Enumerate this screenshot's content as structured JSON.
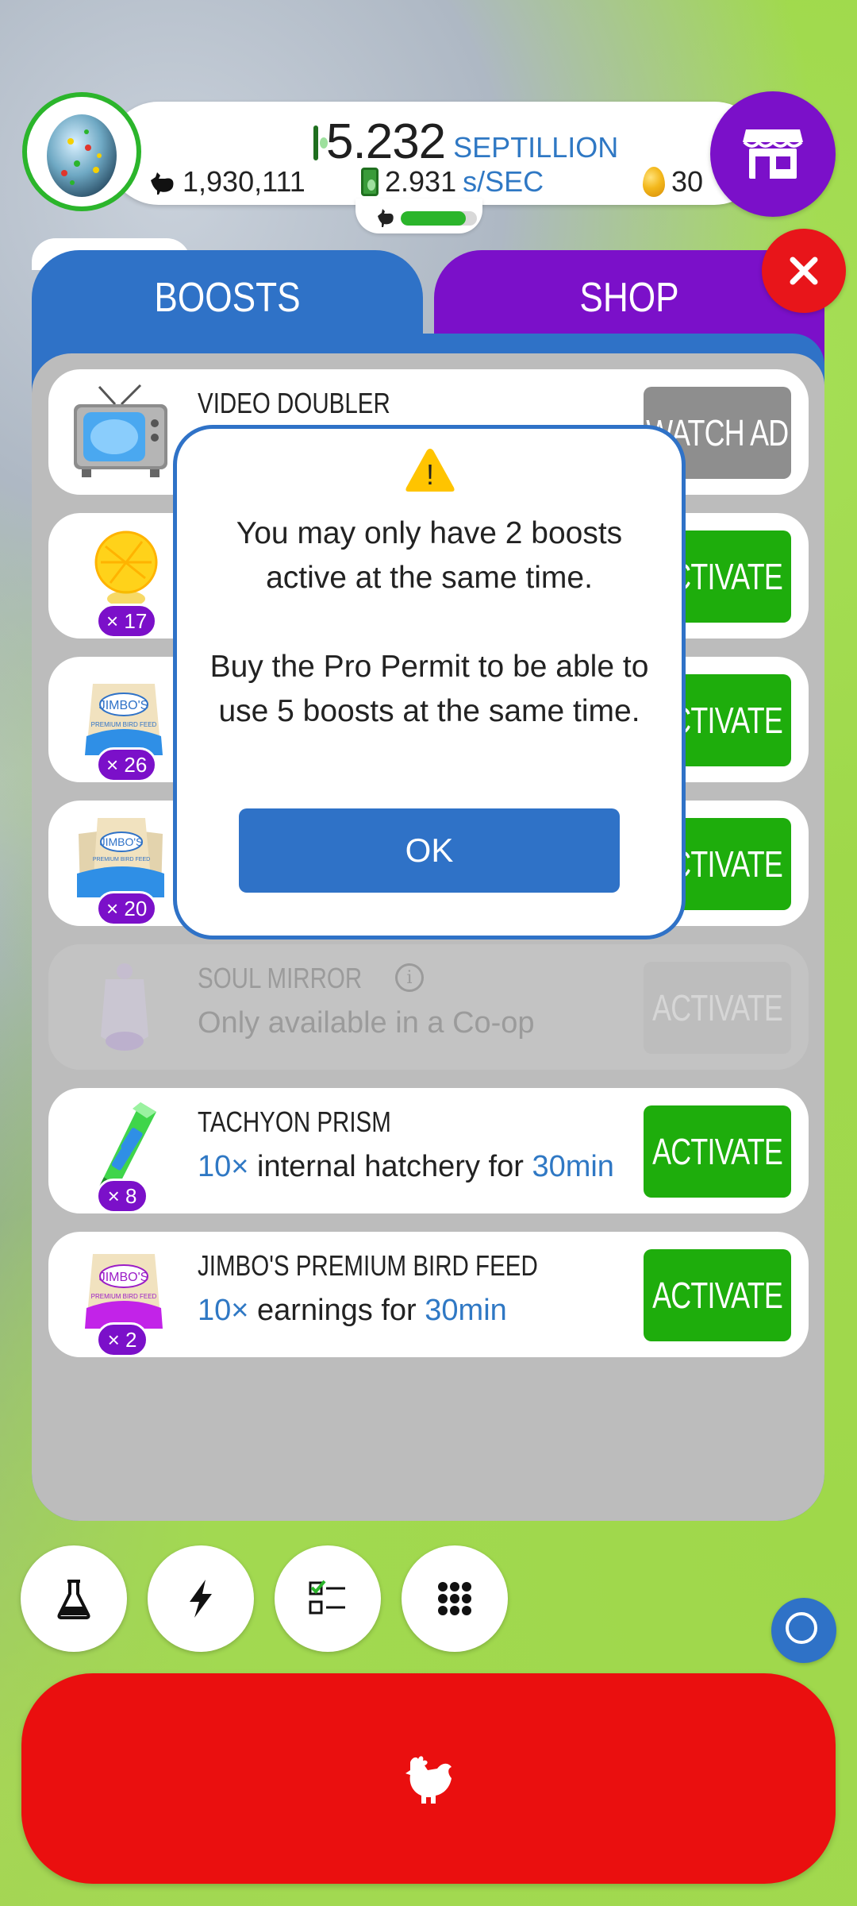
{
  "hud": {
    "money_value": "5.232",
    "money_unit": "SEPTILLION",
    "chicken_count": "1,930,111",
    "rate_value": "2.931",
    "rate_unit": "s/SEC",
    "golden_eggs": "30",
    "habitat_progress": 0.85
  },
  "tabs": [
    {
      "label": "BOOSTS",
      "selected": true
    },
    {
      "label": "SHOP",
      "selected": false
    }
  ],
  "boosts": [
    {
      "title": "VIDEO DOUBLER",
      "count": "",
      "action": "WATCH AD",
      "state": "ad"
    },
    {
      "title": "",
      "count": "× 17",
      "action": "ACTIVATE",
      "state": "active"
    },
    {
      "title": "",
      "count": "× 26",
      "action": "ACTIVATE",
      "state": "active"
    },
    {
      "title": "",
      "count": "× 20",
      "action": "ACTIVATE",
      "state": "active"
    },
    {
      "title": "SOUL MIRROR",
      "desc": "Only available in a Co-op",
      "count": "",
      "action": "ACTIVATE",
      "state": "disabled"
    },
    {
      "title": "TACHYON PRISM",
      "desc_mult": "10×",
      "desc_text": " internal hatchery for ",
      "desc_time": "30min",
      "count": "× 8",
      "action": "ACTIVATE",
      "state": "active"
    },
    {
      "title": "JIMBO'S PREMIUM BIRD FEED",
      "desc_mult": "10×",
      "desc_text": " earnings for ",
      "desc_time": "30min",
      "count": "× 2",
      "action": "ACTIVATE",
      "state": "active"
    }
  ],
  "thumb_labels": {
    "feed_brand": "JIMBO'S",
    "feed_sub": "PREMIUM BIRD FEED"
  },
  "modal": {
    "icon": "warning-icon",
    "icon_glyph": "!",
    "message_1": "You may only have 2 boosts active at the same time.",
    "message_2": "Buy the Pro Permit to be able to use 5 boosts at the same time.",
    "ok_label": "OK"
  },
  "bottom_icons": [
    "flask-icon",
    "lightning-icon",
    "checklist-icon",
    "grid-icon"
  ],
  "hatch_icon": "chicken-icon",
  "colors": {
    "boosts_tab": "#2f72c7",
    "shop_tab": "#7b10c9",
    "activate_green": "#1ead0c",
    "close_red": "#e8151a",
    "hatch_red": "#ea0f0f",
    "accent_blue": "#2f78c4"
  }
}
